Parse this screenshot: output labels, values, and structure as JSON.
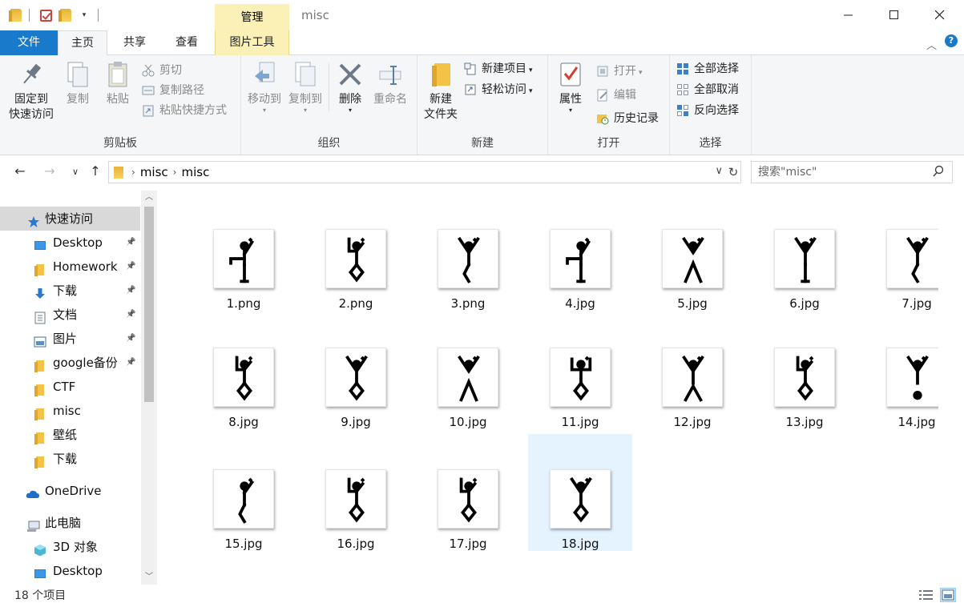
{
  "window": {
    "title": "misc",
    "context_tab": "管理",
    "minimize_icon": "minimize-icon",
    "maximize_icon": "maximize-icon",
    "close_icon": "close-icon"
  },
  "tabs": {
    "file": "文件",
    "home": "主页",
    "share": "共享",
    "view": "查看",
    "picture_tools": "图片工具",
    "active": "主页"
  },
  "ribbon": {
    "clipboard": {
      "label": "剪贴板",
      "pin": "固定到\n快速访问",
      "pin_l1": "固定到",
      "pin_l2": "快速访问",
      "copy": "复制",
      "paste": "粘贴",
      "cut": "剪切",
      "copy_path": "复制路径",
      "paste_shortcut": "粘贴快捷方式"
    },
    "organize": {
      "label": "组织",
      "move_to": "移动到",
      "copy_to": "复制到",
      "delete": "删除",
      "rename": "重命名"
    },
    "new": {
      "label": "新建",
      "new_folder_l1": "新建",
      "new_folder_l2": "文件夹",
      "new_item": "新建项目",
      "easy_access": "轻松访问"
    },
    "open": {
      "label": "打开",
      "properties": "属性",
      "open": "打开",
      "edit": "编辑",
      "history": "历史记录"
    },
    "select": {
      "label": "选择",
      "select_all": "全部选择",
      "select_none": "全部取消",
      "invert": "反向选择"
    }
  },
  "address": {
    "crumbs": [
      "misc",
      "misc"
    ],
    "search_placeholder": "搜索\"misc\""
  },
  "sidebar": {
    "items": [
      {
        "label": "快速访问",
        "icon": "star-icon",
        "pinned": false
      },
      {
        "label": "Desktop",
        "icon": "desktop-icon",
        "pinned": true
      },
      {
        "label": "Homework",
        "icon": "folder-icon",
        "pinned": true
      },
      {
        "label": "下载",
        "icon": "download-icon",
        "pinned": true
      },
      {
        "label": "文档",
        "icon": "document-icon",
        "pinned": true
      },
      {
        "label": "图片",
        "icon": "pictures-icon",
        "pinned": true
      },
      {
        "label": "google备份",
        "icon": "folder-icon",
        "pinned": true
      },
      {
        "label": "CTF",
        "icon": "folder-icon",
        "pinned": false
      },
      {
        "label": "misc",
        "icon": "folder-icon",
        "pinned": false
      },
      {
        "label": "壁纸",
        "icon": "folder-icon",
        "pinned": false
      },
      {
        "label": "下载",
        "icon": "folder-icon",
        "pinned": false
      },
      {
        "label": "OneDrive",
        "icon": "cloud-icon",
        "pinned": false
      },
      {
        "label": "此电脑",
        "icon": "computer-icon",
        "pinned": false
      },
      {
        "label": "3D 对象",
        "icon": "3d-objects-icon",
        "pinned": false
      },
      {
        "label": "Desktop",
        "icon": "desktop-icon",
        "pinned": false
      }
    ]
  },
  "files": [
    {
      "name": "1.png"
    },
    {
      "name": "2.png"
    },
    {
      "name": "3.png"
    },
    {
      "name": "4.jpg"
    },
    {
      "name": "5.jpg"
    },
    {
      "name": "6.jpg"
    },
    {
      "name": "7.jpg"
    },
    {
      "name": "8.jpg"
    },
    {
      "name": "9.jpg"
    },
    {
      "name": "10.jpg"
    },
    {
      "name": "11.jpg"
    },
    {
      "name": "12.jpg"
    },
    {
      "name": "13.jpg"
    },
    {
      "name": "14.jpg"
    },
    {
      "name": "15.jpg"
    },
    {
      "name": "16.jpg"
    },
    {
      "name": "17.jpg"
    },
    {
      "name": "18.jpg"
    }
  ],
  "selected_file": "18.jpg",
  "status": {
    "item_count": "18 个项目"
  },
  "colors": {
    "accent": "#1979ca",
    "context_tab": "#fbf0b5",
    "selection": "#e5f3ff",
    "folder": "#f7d25c"
  }
}
